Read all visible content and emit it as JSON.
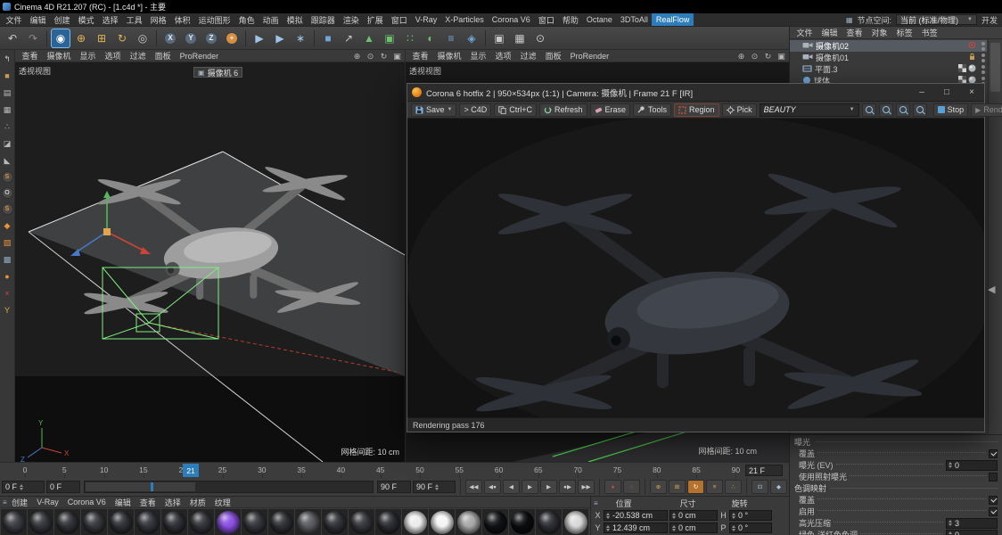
{
  "titlebar": {
    "title": "Cinema 4D R21.207 (RC) - [1.c4d *] - 主要"
  },
  "menubar": {
    "items": [
      "文件",
      "编辑",
      "创建",
      "模式",
      "选择",
      "工具",
      "网格",
      "体积",
      "运动图形",
      "角色",
      "动画",
      "模拟",
      "跟踪器",
      "渲染",
      "扩展",
      "窗口",
      "V-Ray",
      "X-Particles",
      "Corona V6",
      "窗口",
      "帮助",
      "Octane",
      "3DToAll",
      "RealFlow"
    ],
    "highlighted_item": "RealFlow",
    "node_space_label": "节点空间:",
    "node_space_value": "当前 (标准/物理)",
    "dev_label": "开发"
  },
  "main_toolbar": {
    "icons": [
      {
        "name": "undo-icon",
        "glyph": "↶",
        "color": "#c8c8c8"
      },
      {
        "name": "redo-icon",
        "glyph": "↷",
        "color": "#8a8a8a"
      },
      {
        "name": "separator"
      },
      {
        "name": "live-selection-icon",
        "glyph": "◉",
        "color": "#ffffff",
        "active": true
      },
      {
        "name": "move-tool-icon",
        "glyph": "⊕",
        "color": "#e0b254"
      },
      {
        "name": "scale-tool-icon",
        "glyph": "⊞",
        "color": "#e0b254"
      },
      {
        "name": "rotate-tool-icon",
        "glyph": "↻",
        "color": "#e0b254"
      },
      {
        "name": "last-tool-icon",
        "glyph": "◎",
        "color": "#c8c8c8"
      },
      {
        "name": "separator"
      },
      {
        "name": "x-axis-lock-icon",
        "glyph": "X",
        "badge": true
      },
      {
        "name": "y-axis-lock-icon",
        "glyph": "Y",
        "badge": true
      },
      {
        "name": "z-axis-lock-icon",
        "glyph": "Z",
        "badge": true
      },
      {
        "name": "coordinate-system-icon",
        "glyph": "+",
        "badge": true,
        "badge_color": "#d98e3f"
      },
      {
        "name": "separator"
      },
      {
        "name": "render-view-icon",
        "glyph": "▶",
        "color": "#9ec5e8"
      },
      {
        "name": "render-picture-viewer-icon",
        "glyph": "▶",
        "color": "#9ec5e8"
      },
      {
        "name": "render-settings-icon",
        "glyph": "∗",
        "color": "#9ec5e8"
      },
      {
        "name": "separator"
      },
      {
        "name": "add-cube-icon",
        "glyph": "■",
        "color": "#6fa8d8"
      },
      {
        "name": "spline-pen-icon",
        "glyph": "↗",
        "color": "#c8c8c8"
      },
      {
        "name": "subdivision-surface-icon",
        "glyph": "▲",
        "color": "#6fc06f"
      },
      {
        "name": "extrude-icon",
        "glyph": "▣",
        "color": "#6fc06f"
      },
      {
        "name": "array-icon",
        "glyph": "∷",
        "color": "#6fc06f"
      },
      {
        "name": "boole-icon",
        "glyph": "◐",
        "color": "#6fc06f"
      },
      {
        "name": "field-icon",
        "glyph": "≡",
        "color": "#6fa8d8"
      },
      {
        "name": "volume-icon",
        "glyph": "◈",
        "color": "#6fa8d8"
      },
      {
        "name": "separator"
      },
      {
        "name": "camera-tool-icon",
        "glyph": "▣",
        "color": "#c8c8c8"
      },
      {
        "name": "floor-tool-icon",
        "glyph": "▦",
        "color": "#c8c8c8"
      },
      {
        "name": "magnify-tool-icon",
        "glyph": "⊙",
        "color": "#c8c8c8"
      }
    ]
  },
  "left_toolbar": {
    "icons": [
      {
        "name": "make-editable-icon",
        "glyph": "↰",
        "color": "#c8c8c8"
      },
      {
        "name": "model-mode-icon",
        "glyph": "■",
        "color": "#c89a5a"
      },
      {
        "name": "texture-mode-icon",
        "glyph": "▤",
        "color": "#b8b8b8"
      },
      {
        "name": "workplane-mode-icon",
        "glyph": "▦",
        "color": "#b8b8b8"
      },
      {
        "name": "point-mode-icon",
        "glyph": "∴",
        "color": "#b8b8b8"
      },
      {
        "name": "edge-mode-icon",
        "glyph": "◪",
        "color": "#b8b8b8"
      },
      {
        "name": "polygon-mode-icon",
        "glyph": "◣",
        "color": "#b8b8b8"
      },
      {
        "name": "enable-axis-icon",
        "glyph": "S",
        "circle": true,
        "color": "#e8923a"
      },
      {
        "name": "solo-mode-icon",
        "glyph": "O",
        "circle": true,
        "color": "#c8c8c8"
      },
      {
        "name": "enable-snap-icon",
        "glyph": "S",
        "circle": true,
        "color": "#e8923a"
      },
      {
        "name": "viewport-solo-icon",
        "glyph": "◆",
        "color": "#e8923a"
      },
      {
        "name": "quantize-icon",
        "glyph": "▨",
        "color": "#e8923a"
      },
      {
        "name": "workplane-lock-icon",
        "glyph": "▩",
        "color": "#8fa8c0"
      },
      {
        "name": "lock-axis-icon",
        "glyph": "●",
        "color": "#e8923a"
      },
      {
        "name": "x-ray-icon",
        "glyph": "×",
        "color": "#d24a3a"
      },
      {
        "name": "isoline-icon",
        "glyph": "Y",
        "color": "#d2b43a"
      }
    ]
  },
  "viewports": {
    "nav_icons": [
      {
        "name": "pan-view-icon",
        "glyph": "⊕"
      },
      {
        "name": "zoom-view-icon",
        "glyph": "⊙"
      },
      {
        "name": "rotate-view-icon",
        "glyph": "↻"
      },
      {
        "name": "toggle-view-icon",
        "glyph": "▣"
      }
    ],
    "left": {
      "menus": [
        "查看",
        "摄像机",
        "显示",
        "选项",
        "过滤",
        "面板",
        "ProRender"
      ],
      "label": "透视视图",
      "camera_hud": "摄像机 6",
      "grid_label": "网格间距: 10 cm"
    },
    "right": {
      "menus": [
        "查看",
        "摄像机",
        "显示",
        "选项",
        "过滤",
        "面板",
        "ProRender"
      ],
      "label": "透视视图",
      "grid_label": "网格间距: 10 cm"
    }
  },
  "object_manager": {
    "menus": [
      "文件",
      "编辑",
      "查看",
      "对象",
      "标签",
      "书签"
    ],
    "items": [
      {
        "name": "camera-02",
        "label": "摄像机02",
        "icon": "camera",
        "selected": true,
        "tags": [
          "target"
        ]
      },
      {
        "name": "camera-01",
        "label": "摄像机01",
        "icon": "camera",
        "selected": false,
        "tags": [
          "protect"
        ]
      },
      {
        "name": "plane-3",
        "label": "平面.3",
        "icon": "plane",
        "selected": false,
        "tags": [
          "texture",
          "phong"
        ]
      },
      {
        "name": "sphere",
        "label": "球体",
        "icon": "sphere",
        "selected": false,
        "tags": [
          "texture",
          "phong"
        ]
      }
    ]
  },
  "corona_window": {
    "title": "Corona 6 hotfix 2 | 950×534px (1:1) | Camera: 摄像机 | Frame 21 F [IR]",
    "buttons": {
      "save": "Save",
      "to_c4d": "> C4D",
      "copy": "Ctrl+C",
      "refresh": "Refresh",
      "erase": "Erase",
      "tools": "Tools",
      "region": "Region",
      "pick": "Pick",
      "stop": "Stop",
      "render": "Render"
    },
    "channel": "BEAUTY",
    "status": "Rendering pass 176",
    "window_controls": [
      {
        "name": "minimize-button",
        "glyph": "–"
      },
      {
        "name": "maximize-button",
        "glyph": "□"
      },
      {
        "name": "close-button",
        "glyph": "×"
      }
    ]
  },
  "timeline": {
    "ticks": [
      "0",
      "5",
      "10",
      "15",
      "20",
      "25",
      "30",
      "35",
      "40",
      "45",
      "50",
      "55",
      "60",
      "65",
      "70",
      "75",
      "80",
      "85",
      "90"
    ],
    "current_frame": "21",
    "current_frame_field": "21 F",
    "start_spinner": "0 F",
    "start_field": "0 F",
    "end_field": "90 F",
    "end_spinner": "90 F"
  },
  "transport": {
    "playback": [
      {
        "name": "goto-start-button",
        "glyph": "◀◀"
      },
      {
        "name": "previous-key-button",
        "glyph": "◀●"
      },
      {
        "name": "previous-frame-button",
        "glyph": "◀"
      },
      {
        "name": "play-button",
        "glyph": "▶"
      },
      {
        "name": "next-frame-button",
        "glyph": "▶"
      },
      {
        "name": "next-key-button",
        "glyph": "●▶"
      },
      {
        "name": "goto-end-button",
        "glyph": "▶▶"
      }
    ],
    "record": [
      {
        "name": "record-active-objects-button",
        "glyph": "●",
        "color": "#d24a3a"
      },
      {
        "name": "autokey-button",
        "glyph": "○",
        "color": "#d24a3a"
      }
    ],
    "key_toggles": [
      {
        "name": "record-position-toggle",
        "glyph": "⊕",
        "color": "#e0a64e"
      },
      {
        "name": "record-scale-toggle",
        "glyph": "⊞",
        "color": "#e0a64e"
      },
      {
        "name": "record-rotation-toggle",
        "glyph": "↻",
        "color": "#ffffff",
        "active": true
      },
      {
        "name": "record-parameter-toggle",
        "glyph": "≡",
        "color": "#e0a64e"
      },
      {
        "name": "record-pla-toggle",
        "glyph": "∴",
        "color": "#e0a64e"
      }
    ],
    "extra": [
      {
        "name": "keyframe-selection-button",
        "glyph": "⊡",
        "color": "#9ec5e8"
      },
      {
        "name": "minimal-interface-button",
        "glyph": "◆",
        "color": "#9ec5e8"
      }
    ]
  },
  "material_manager": {
    "menus": [
      "创建",
      "V-Ray",
      "Corona V6",
      "编辑",
      "查看",
      "选择",
      "材质",
      "纹理"
    ],
    "swatches": [
      "#3a3b40",
      "#34353a",
      "#303136",
      "#35363b",
      "#2f3035",
      "#33343a",
      "#2e2f34",
      "#323338",
      "#8a4fe0",
      "#34353a",
      "#2f3034",
      "#5a5b60",
      "#303136",
      "#35363b",
      "#2c2d32",
      "#ececec",
      "#f4f4f4",
      "#a8a8a8",
      "#101114",
      "#0b0c0e",
      "#2e2f34",
      "#d8d8d8"
    ]
  },
  "coordinate_manager": {
    "headers": [
      "位置",
      "尺寸",
      "旋转"
    ],
    "rows": [
      {
        "axis": "X",
        "position": "-20.538 cm",
        "size": "0 cm",
        "rot_label": "H",
        "rotation": "0 °"
      },
      {
        "axis": "Y",
        "position": "12.439 cm",
        "size": "0 cm",
        "rot_label": "P",
        "rotation": "0 °"
      }
    ]
  },
  "attribute_manager": {
    "sections": [
      {
        "name": "exposure",
        "title": "曝光",
        "rows": [
          {
            "name": "override-exposure",
            "label": "覆盖",
            "control": "checkbox",
            "checked": true
          },
          {
            "name": "exposure-ev",
            "label": "曝光 (EV)",
            "control": "field",
            "value": "0"
          },
          {
            "name": "use-photographic-exposure",
            "label": "使用照射曝光",
            "control": "checkbox",
            "checked": false
          }
        ]
      },
      {
        "name": "tone-mapping",
        "title": "色调映射",
        "rows": [
          {
            "name": "override-tone-mapping",
            "label": "覆盖",
            "control": "checkbox",
            "checked": true
          },
          {
            "name": "enable-tone-mapping",
            "label": "启用",
            "control": "checkbox",
            "checked": true
          },
          {
            "name": "highlight-compression",
            "label": "高光压缩",
            "control": "field",
            "value": "3"
          },
          {
            "name": "green-magenta-tint",
            "label": "绿色-洋红色色调",
            "control": "field",
            "value": "0"
          }
        ]
      }
    ]
  },
  "colors": {
    "accent_blue": "#2d7dbb",
    "region_red": "#e05838",
    "selection_green": "#7ef07e",
    "axis_red": "#cc4438",
    "axis_green": "#58b658",
    "axis_blue": "#4878c8"
  }
}
